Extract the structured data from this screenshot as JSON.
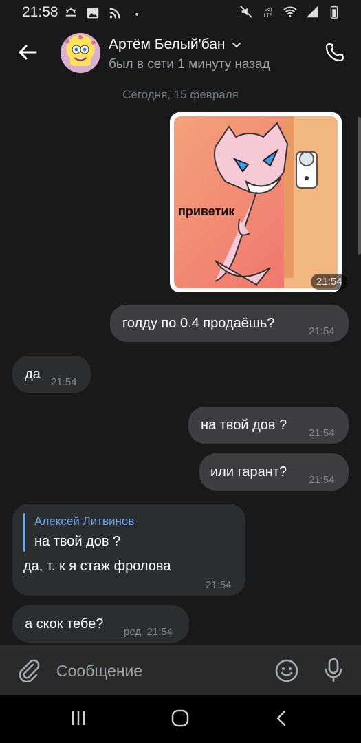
{
  "status_bar": {
    "time": "21:58",
    "left_icons": [
      "weather-icon",
      "image-icon",
      "rss-icon",
      "dot-icon"
    ],
    "right_icons": [
      "mute-icon",
      "volte-icon",
      "wifi-icon",
      "signal-icon",
      "battery-icon"
    ],
    "volte_label": "Vo) LTE"
  },
  "header": {
    "name": "Артём Белый'бан",
    "status": "был в сети 1 минуту назад"
  },
  "conversation": {
    "date_separator": "Сегодня, 15 февраля",
    "sticker": {
      "caption": "приветик",
      "time": "21:54"
    },
    "messages": [
      {
        "direction": "out",
        "text": "голду по 0.4 продаёшь?",
        "time": "21:54"
      },
      {
        "direction": "in",
        "text": "да",
        "time": "21:54"
      },
      {
        "direction": "out",
        "text": "на твой дов ?",
        "time": "21:54"
      },
      {
        "direction": "out",
        "text": "или гарант?",
        "time": "21:54"
      },
      {
        "direction": "in",
        "reply_author": "Алексей Литвинов",
        "reply_text": "на твой дов ?",
        "text": "да, т. к я стаж фролова",
        "time": "21:54"
      },
      {
        "direction": "in",
        "text": "а скок тебе?",
        "time": "ред. 21:54"
      }
    ]
  },
  "composer": {
    "placeholder": "Сообщение"
  },
  "colors": {
    "background": "#19191a",
    "outgoing_bubble": "#3e3e40",
    "incoming_bubble": "#2c2d2e",
    "accent": "#71aaeb"
  }
}
